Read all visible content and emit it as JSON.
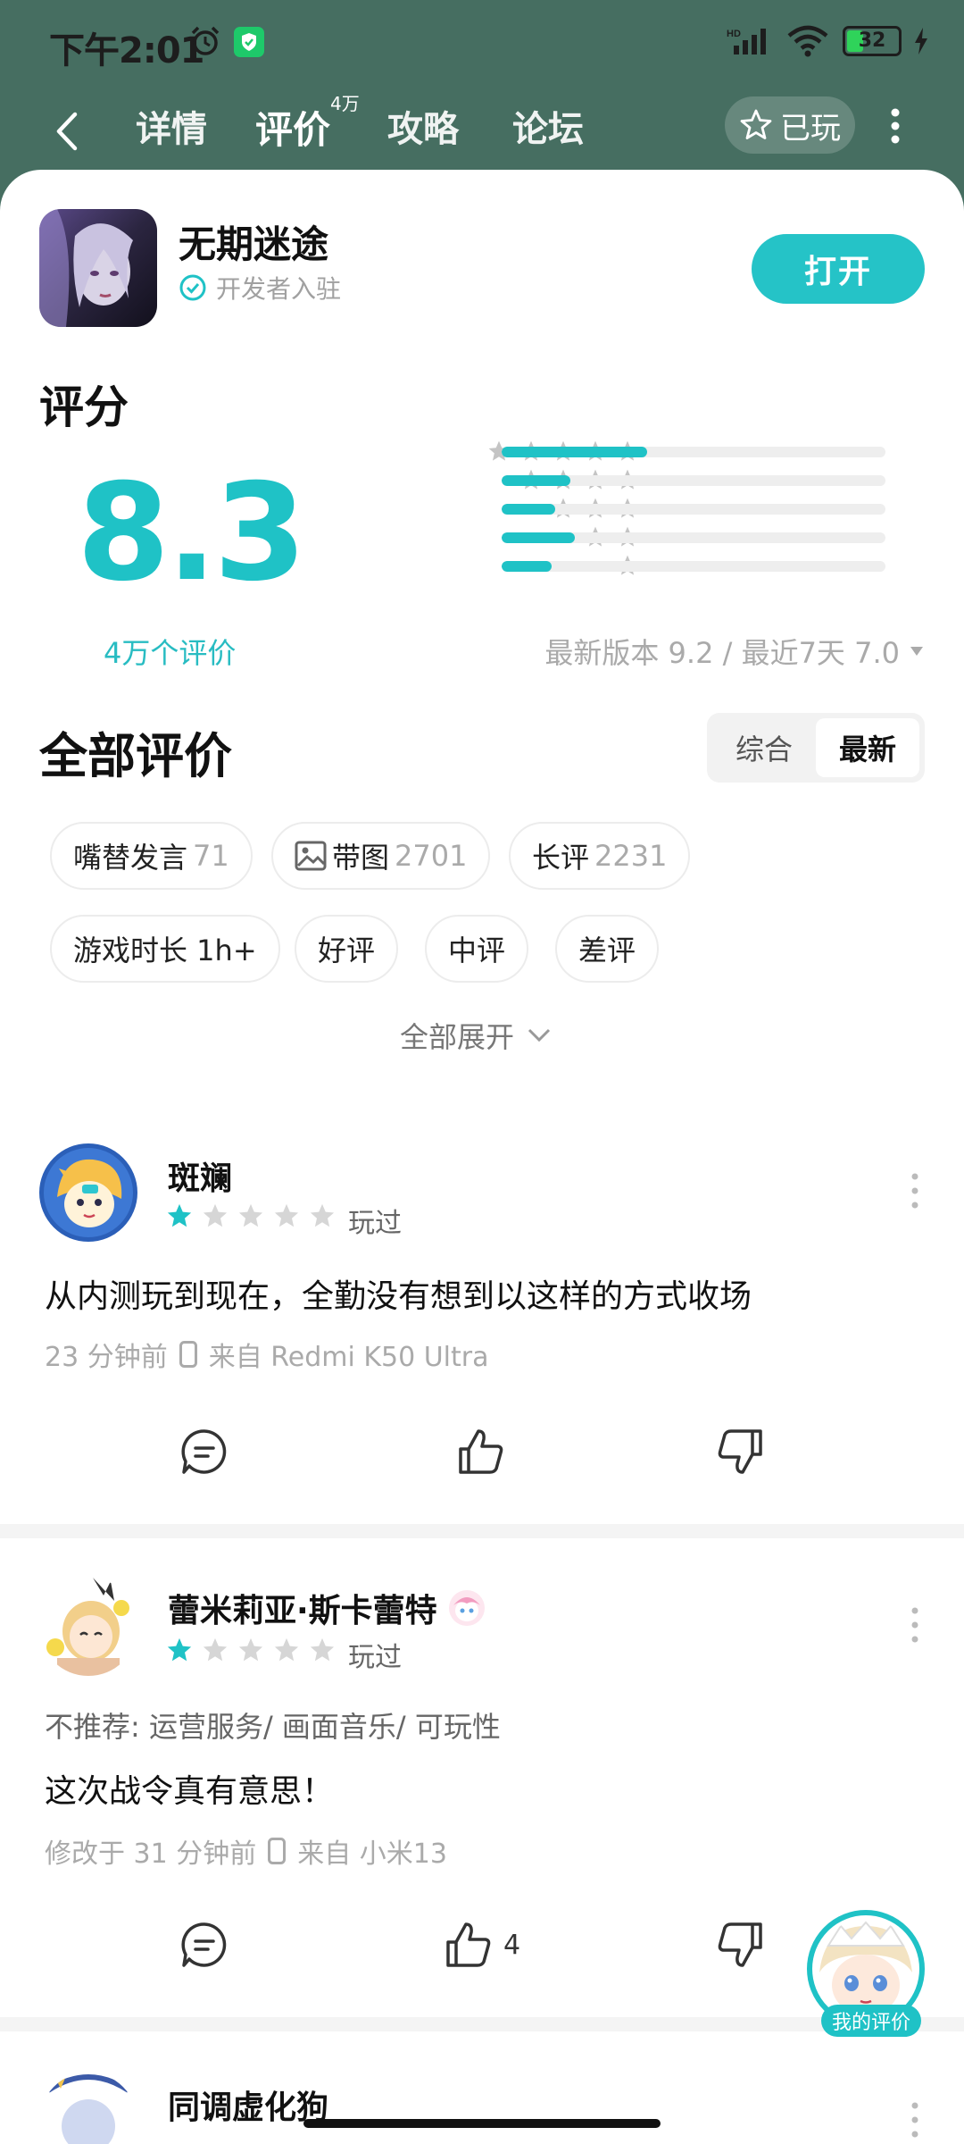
{
  "status": {
    "time": "下午2:01",
    "battery": "32"
  },
  "nav": {
    "tabs": [
      {
        "label": "详情"
      },
      {
        "label": "评价"
      },
      {
        "label": "攻略"
      },
      {
        "label": "论坛"
      }
    ],
    "review_badge": "4万",
    "played_label": "已玩"
  },
  "app": {
    "name": "无期迷途",
    "verified_label": "开发者入驻",
    "open_label": "打开"
  },
  "rating": {
    "title": "评分",
    "score": "8.3",
    "count": "4万个评价",
    "distribution": [
      {
        "stars": 5,
        "fraction": 0.38
      },
      {
        "stars": 4,
        "fraction": 0.18
      },
      {
        "stars": 3,
        "fraction": 0.14
      },
      {
        "stars": 2,
        "fraction": 0.19
      },
      {
        "stars": 1,
        "fraction": 0.13
      }
    ],
    "latest_version": "最新版本 9.2 / 最近7天 7.0"
  },
  "all_reviews": {
    "title": "全部评价",
    "sort_options": [
      "综合",
      "最新"
    ],
    "sort_selected": "最新",
    "chips": [
      {
        "label": "嘴替发言",
        "count": "71"
      },
      {
        "label": "带图",
        "count": "2701",
        "icon": "image-icon"
      },
      {
        "label": "长评",
        "count": "2231"
      },
      {
        "label": "游戏时长 1h+",
        "count": ""
      },
      {
        "label": "好评",
        "count": ""
      },
      {
        "label": "中评",
        "count": ""
      },
      {
        "label": "差评",
        "count": ""
      }
    ],
    "expand_label": "全部展开"
  },
  "reviews": [
    {
      "user": "斑斓",
      "stars": 1,
      "played": "玩过",
      "tags": "",
      "text": "从内测玩到现在，全勤没有想到以这样的方式收场",
      "time": "23 分钟前",
      "device": "来自 Redmi K50 Ultra",
      "likes": ""
    },
    {
      "user": "蕾米莉亚·斯卡蕾特",
      "stars": 1,
      "played": "玩过",
      "tags": "不推荐: 运营服务/ 画面音乐/ 可玩性",
      "text": "这次战令真有意思！",
      "time": "修改于 31 分钟前",
      "device": "来自 小米13",
      "likes": "4"
    },
    {
      "user": "同调虚化狗"
    }
  ],
  "fab": {
    "label": "我的评价"
  },
  "colors": {
    "accent": "#1fc2c6",
    "header_bg": "#466e61"
  }
}
